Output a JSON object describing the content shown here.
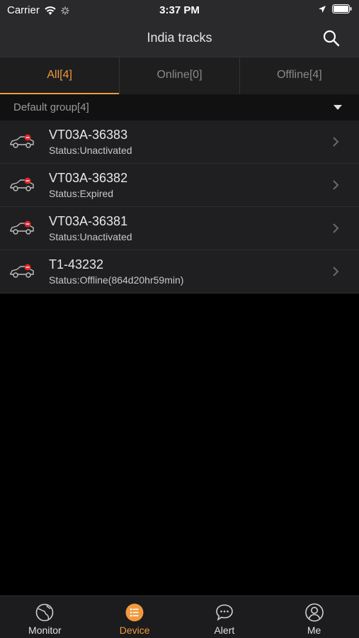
{
  "status_bar": {
    "carrier": "Carrier",
    "time": "3:37 PM"
  },
  "nav": {
    "title": "India tracks",
    "search_icon": "search-icon"
  },
  "filter_tabs": [
    {
      "label": "All[4]",
      "active": true
    },
    {
      "label": "Online[0]",
      "active": false
    },
    {
      "label": "Offline[4]",
      "active": false
    }
  ],
  "group": {
    "label": "Default group[4]"
  },
  "devices": [
    {
      "name": "VT03A-36383",
      "status": "Status:Unactivated"
    },
    {
      "name": "VT03A-36382",
      "status": "Status:Expired"
    },
    {
      "name": "VT03A-36381",
      "status": "Status:Unactivated"
    },
    {
      "name": "T1-43232",
      "status": "Status:Offline(864d20hr59min)"
    }
  ],
  "bottom_tabs": [
    {
      "label": "Monitor",
      "icon": "globe-icon",
      "active": false
    },
    {
      "label": "Device",
      "icon": "list-icon",
      "active": true
    },
    {
      "label": "Alert",
      "icon": "chat-bubble-icon",
      "active": false
    },
    {
      "label": "Me",
      "icon": "user-icon",
      "active": false
    }
  ],
  "colors": {
    "accent": "#f09a3e",
    "background": "#000000",
    "bar": "#2a2a2c",
    "alert_red": "#e0262a"
  }
}
